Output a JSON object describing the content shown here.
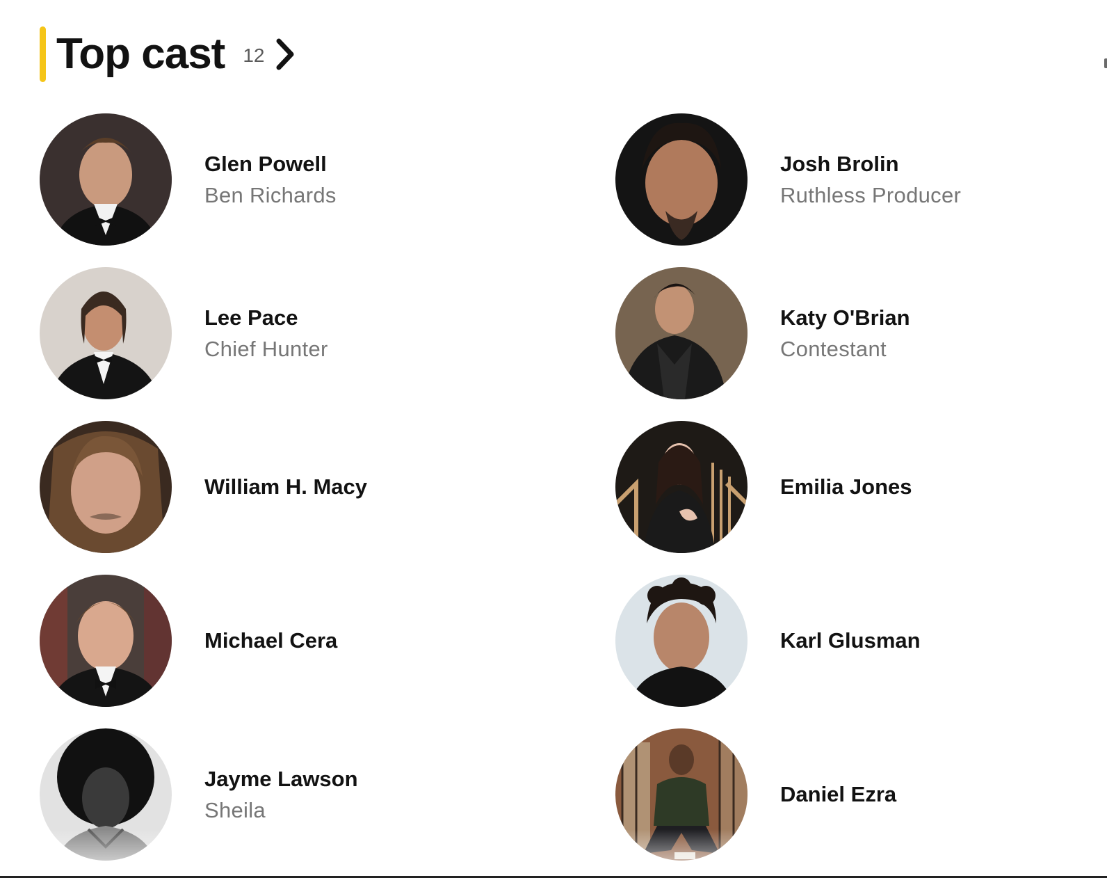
{
  "section": {
    "title": "Top cast",
    "count": "12",
    "accent_color": "#f5c518"
  },
  "cast": [
    {
      "name": "Glen Powell",
      "character": "Ben Richards",
      "photo": "portrait-glen-powell",
      "tone": "#3a3230"
    },
    {
      "name": "Josh Brolin",
      "character": "Ruthless Producer",
      "photo": "portrait-josh-brolin",
      "tone": "#1d1b1a"
    },
    {
      "name": "Lee Pace",
      "character": "Chief Hunter",
      "photo": "portrait-lee-pace",
      "tone": "#cfc8c2"
    },
    {
      "name": "Katy O'Brian",
      "character": "Contestant",
      "photo": "portrait-katy-obrian",
      "tone": "#6e5a48"
    },
    {
      "name": "William H. Macy",
      "character": "",
      "photo": "portrait-william-h-macy",
      "tone": "#7a5a3a"
    },
    {
      "name": "Emilia Jones",
      "character": "",
      "photo": "portrait-emilia-jones",
      "tone": "#2a2420"
    },
    {
      "name": "Michael Cera",
      "character": "",
      "photo": "portrait-michael-cera",
      "tone": "#5a4a44"
    },
    {
      "name": "Karl Glusman",
      "character": "",
      "photo": "portrait-karl-glusman",
      "tone": "#dfe6ea"
    },
    {
      "name": "Jayme Lawson",
      "character": "Sheila",
      "photo": "portrait-jayme-lawson",
      "tone": "#9a9a9a"
    },
    {
      "name": "Daniel Ezra",
      "character": "",
      "photo": "portrait-daniel-ezra",
      "tone": "#6a4a36"
    }
  ]
}
